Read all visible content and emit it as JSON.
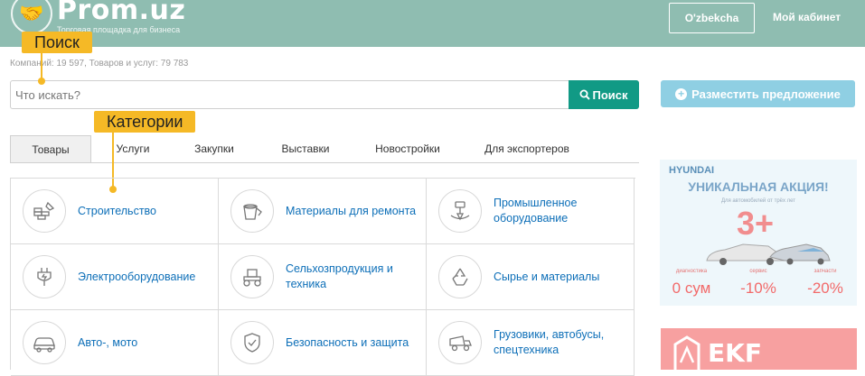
{
  "header": {
    "logo_text": "Prom.uz",
    "tagline": "Торговая площадка для бизнеса",
    "lang_button": "O'zbekcha",
    "cabinet_link": "Мой кабинет"
  },
  "stats": "Компаний: 19 597, Товаров и услуг: 79 783",
  "search": {
    "placeholder": "Что искать?",
    "button": "Поиск"
  },
  "place_offer": "Разместить предложение",
  "callouts": {
    "search": "Поиск",
    "categories": "Категории"
  },
  "tabs": [
    "Товары",
    "Услуги",
    "Закупки",
    "Выставки",
    "Новостройки",
    "Для экспортеров"
  ],
  "categories": [
    {
      "label": "Строительство",
      "icon": "bricks-icon"
    },
    {
      "label": "Материалы для ремонта",
      "icon": "paint-bucket-icon"
    },
    {
      "label": "Промышленное оборудование",
      "icon": "drill-icon"
    },
    {
      "label": "Электрооборудование",
      "icon": "plug-icon"
    },
    {
      "label": "Сельхозпродукция и техника",
      "icon": "tractor-icon"
    },
    {
      "label": "Сырье и материалы",
      "icon": "recycle-icon"
    },
    {
      "label": "Авто-, мото",
      "icon": "car-icon"
    },
    {
      "label": "Безопасность и защита",
      "icon": "shield-icon"
    },
    {
      "label": "Грузовики, автобусы, спецтехника",
      "icon": "truck-icon"
    }
  ],
  "banner1": {
    "brand": "HYUNDAI",
    "title": "УНИКАЛЬНАЯ АКЦИЯ!",
    "subtitle": "Для автомобилей от трёх лет",
    "big": "3+",
    "items": [
      {
        "label": "диагностика",
        "value": "0 сум"
      },
      {
        "label": "сервис",
        "value": "-10%"
      },
      {
        "label": "запчасти",
        "value": "-20%"
      }
    ]
  },
  "banner2": {
    "brand": "EKF"
  },
  "colors": {
    "header_bg": "#8fbdb1",
    "search_button": "#119a85",
    "place_button": "#8fcfe3",
    "callout": "#f5b926",
    "link": "#0d6fb8"
  }
}
